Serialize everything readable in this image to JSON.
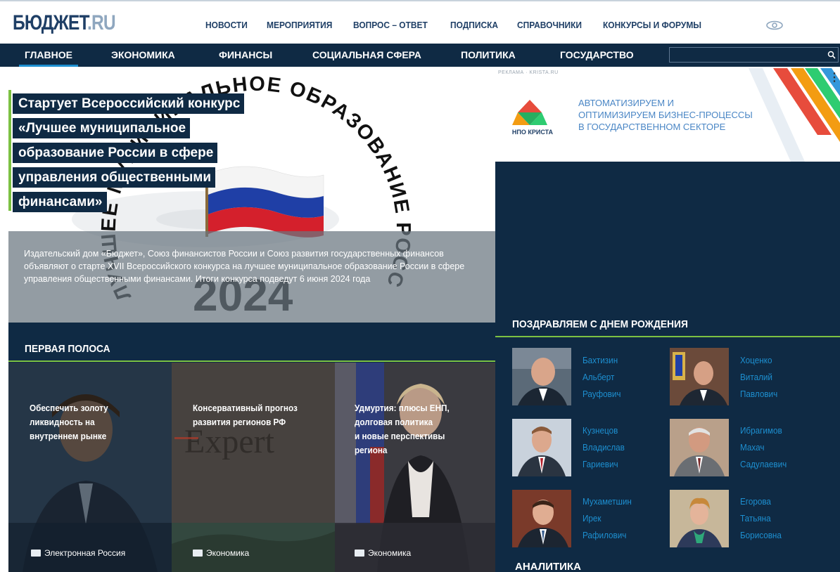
{
  "header": {
    "logo_main": "БЮДЖЕТ",
    "logo_suffix": ".RU",
    "top_nav": [
      "НОВОСТИ",
      "МЕРОПРИЯТИЯ",
      "ВОПРОС – ОТВЕТ",
      "ПОДПИСКА",
      "СПРАВОЧНИКИ",
      "КОНКУРСЫ И ФОРУМЫ"
    ],
    "accessibility_icon": "eye-icon"
  },
  "main_nav": {
    "items": [
      "ГЛАВНОЕ",
      "ЭКОНОМИКА",
      "ФИНАНСЫ",
      "СОЦИАЛЬНАЯ СФЕРА",
      "ПОЛИТИКА",
      "ГОСУДАРСТВО"
    ],
    "active": "ГЛАВНОЕ",
    "search_icon": "search-icon"
  },
  "hero": {
    "title_lines": [
      "Стартует Всероссийский конкурс",
      "«Лучшее муниципальное",
      "образование России в сфере",
      "управления общественными",
      "финансами»"
    ],
    "lead": "Издательский дом «Бюджет», Союз финансистов России и Союз развития государственных финансов объявляют о старте XVII Всероссийского конкурса на лучшее муниципальное образование России в сфере управления общественными финансами. Итоги конкурса подведут 6 июня 2024 года",
    "emblem_arc_text": "ЛУЧШЕЕ МУНИЦИПАЛЬНОЕ ОБРАЗОВАНИЕ РОССИИ",
    "emblem_year": "2024"
  },
  "ad": {
    "label": "РЕКЛАМА · KRISTA.RU",
    "brand": "НПО КРИСТА",
    "text_lines": [
      "АВТОМАТИЗИРУЕМ И",
      "ОПТИМИЗИРУЕМ БИЗНЕС-ПРОЦЕССЫ",
      "В ГОСУДАРСТВЕННОМ СЕКТОРЕ"
    ],
    "menu_icon": "more-vertical-icon",
    "colors": [
      "#e74c3c",
      "#f39c12",
      "#2ecc71",
      "#3498db"
    ]
  },
  "birthdays": {
    "heading": "ПОЗДРАВЛЯЕМ С ДНЕМ РОЖДЕНИЯ",
    "people": [
      {
        "lines": [
          "Бахтизин",
          "Альберт",
          "Рауфович"
        ]
      },
      {
        "lines": [
          "Хоценко",
          "Виталий",
          "Павлович"
        ]
      },
      {
        "lines": [
          "Кузнецов",
          "Владислав",
          "Гариевич"
        ]
      },
      {
        "lines": [
          "Ибрагимов",
          "Махач",
          "Садулаевич"
        ]
      },
      {
        "lines": [
          "Мухаметшин",
          "Ирек",
          "Рафилович"
        ]
      },
      {
        "lines": [
          "Егорова",
          "Татьяна",
          "Борисовна"
        ]
      }
    ]
  },
  "analytics": {
    "heading": "АНАЛИТИКА"
  },
  "first_page": {
    "heading": "ПЕРВАЯ ПОЛОСА",
    "cards": [
      {
        "title_lines": [
          "Обеспечить золоту",
          "ликвидность на",
          "внутреннем рынке"
        ],
        "tag": "Электронная Россия"
      },
      {
        "title_lines": [
          "Консервативный прогноз",
          "развития регионов РФ"
        ],
        "tag": "Экономика",
        "image_word": "Expert"
      },
      {
        "title_lines": [
          "Удмуртия: плюсы ЕНП,",
          "долговая политика",
          "и новые перспективы",
          "региона"
        ],
        "tag": "Экономика"
      }
    ]
  },
  "colors": {
    "navy": "#0f2a44",
    "accent_green": "#7cc142",
    "link_blue": "#1d8fd0",
    "logo_blue": "#1f3f66"
  }
}
